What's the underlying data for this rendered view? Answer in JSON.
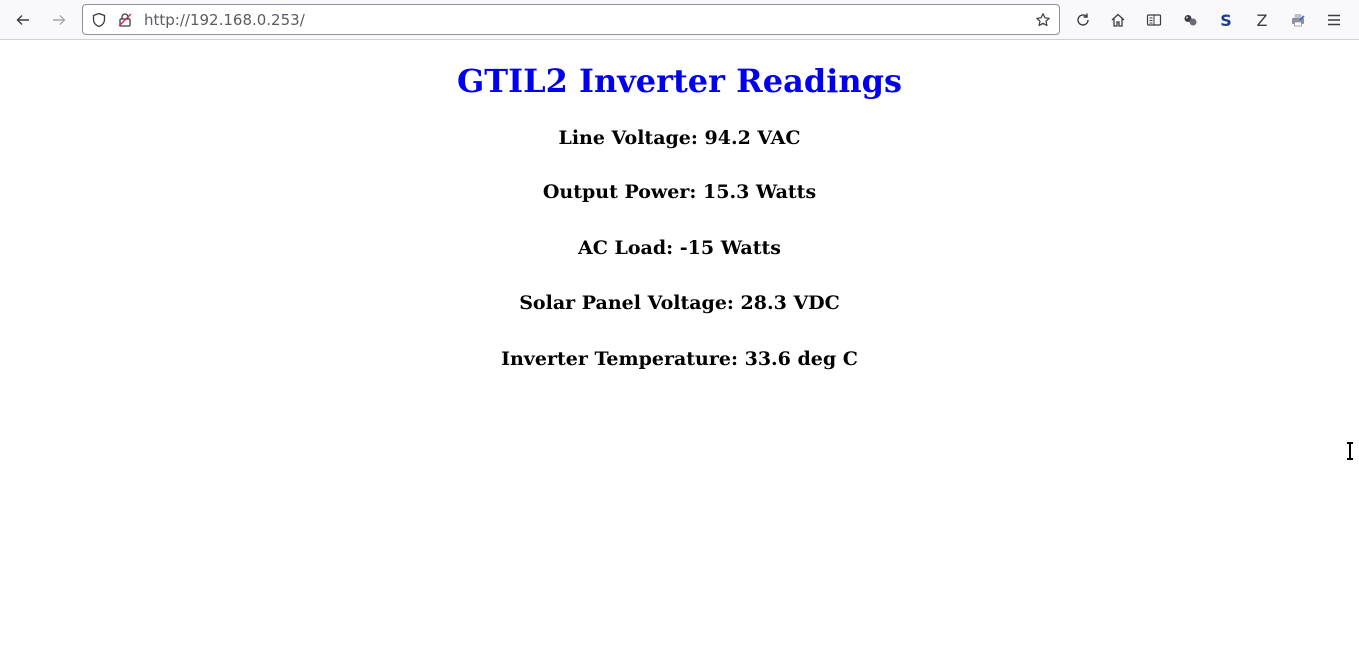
{
  "browser": {
    "url": "http://192.168.0.253/",
    "extension_s_label": "S",
    "extension_z_label": "Z"
  },
  "page": {
    "title": "GTIL2 Inverter Readings",
    "readings": [
      "Line Voltage: 94.2 VAC",
      "Output Power: 15.3 Watts",
      "AC Load: -15 Watts",
      "Solar Panel Voltage: 28.3 VDC",
      "Inverter Temperature: 33.6 deg C"
    ]
  },
  "colors": {
    "title": "#0000ee",
    "text": "#000000",
    "toolbar": "#f9f9fb",
    "extension_s": "#1a3f8c"
  }
}
